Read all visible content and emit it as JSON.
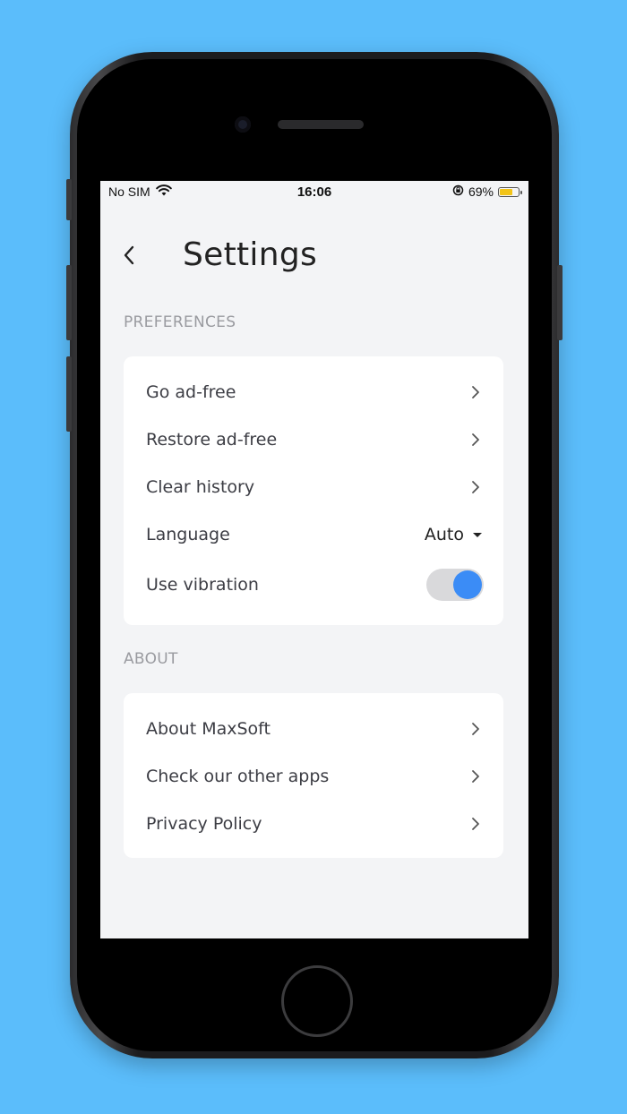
{
  "status_bar": {
    "carrier": "No SIM",
    "time": "16:06",
    "battery": "69%",
    "battery_level": 0.69,
    "battery_color": "#f2c418"
  },
  "header": {
    "title": "Settings",
    "back_icon": "chevron-left-icon"
  },
  "sections": {
    "preferences": {
      "label": "PREFERENCES",
      "items": {
        "go_ad_free": "Go ad-free",
        "restore_ad_free": "Restore ad-free",
        "clear_history": "Clear history",
        "language": "Language",
        "language_value": "Auto",
        "use_vibration": "Use vibration",
        "use_vibration_on": true
      }
    },
    "about": {
      "label": "ABOUT",
      "items": {
        "about_maxsoft": "About MaxSoft",
        "other_apps": "Check our other apps",
        "privacy_policy": "Privacy Policy"
      }
    }
  },
  "colors": {
    "background": "#5bbdfb",
    "screen": "#f3f4f6",
    "accent": "#3b8cf6"
  }
}
